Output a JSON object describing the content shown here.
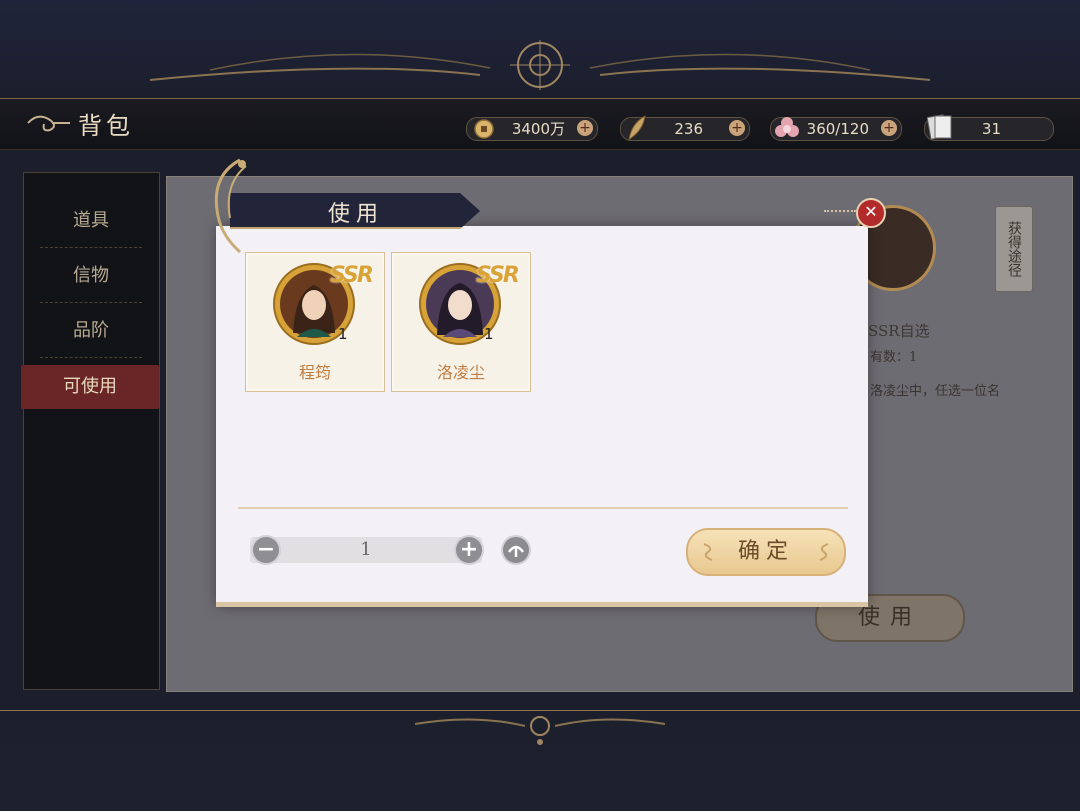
{
  "header": {
    "title": "背包"
  },
  "resources": [
    {
      "icon": "coin-icon",
      "value": "3400万"
    },
    {
      "icon": "feather-icon",
      "value": "236"
    },
    {
      "icon": "flower-icon",
      "value": "360/120"
    },
    {
      "icon": "card-icon",
      "value": "31"
    }
  ],
  "sidebar": {
    "items": [
      {
        "label": "道具"
      },
      {
        "label": "信物"
      },
      {
        "label": "品阶"
      },
      {
        "label": "可使用"
      }
    ]
  },
  "background": {
    "obtain_label": "获得途径",
    "item_title": "SSR自选",
    "owned_text": "有数：1",
    "desc_text": "洛凌尘中，任选一位名",
    "use_button": "使用"
  },
  "dialog": {
    "title": "使用",
    "items": [
      {
        "name": "程筠",
        "rarity": "SSR",
        "count": "1"
      },
      {
        "name": "洛凌尘",
        "rarity": "SSR",
        "count": "1"
      }
    ],
    "quantity": "1",
    "confirm_label": "确定"
  }
}
